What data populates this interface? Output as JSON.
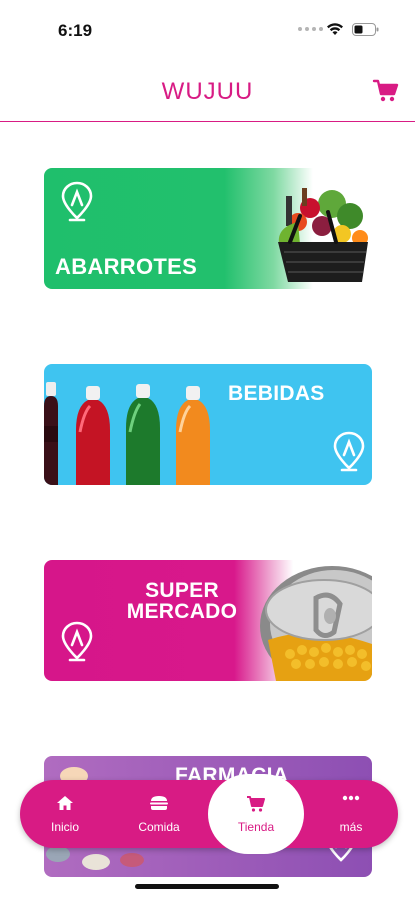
{
  "status_bar": {
    "time": "6:19",
    "icons": [
      "signal-dots-icon",
      "wifi-icon",
      "battery-icon"
    ]
  },
  "header": {
    "title": "WUJUU",
    "cart_icon": "shopping-cart-icon"
  },
  "categories": [
    {
      "label": "ABARROTES",
      "color": "#1fbf6c",
      "icon": "location-pin-icon",
      "image": "grocery-basket"
    },
    {
      "label": "BEBIDAS",
      "color": "#3fc4f0",
      "icon": "location-pin-icon",
      "image": "soda-bottles"
    },
    {
      "label_line1": "SUPER",
      "label_line2": "MERCADO",
      "color": "#d6168a",
      "icon": "location-pin-icon",
      "image": "open-can"
    },
    {
      "label": "FARMACIA",
      "color": "#9b5cbb",
      "icon": "location-pin-icon",
      "image": "pills"
    }
  ],
  "bottom_nav": {
    "items": [
      {
        "label": "Inicio",
        "icon": "home-icon"
      },
      {
        "label": "Comida",
        "icon": "burger-icon"
      },
      {
        "label": "Tienda",
        "icon": "shopping-cart-icon",
        "active": true
      },
      {
        "label": "más",
        "icon": "more-dots-icon"
      }
    ]
  },
  "colors": {
    "brand": "#d81b84",
    "abarrotes": "#1fbf6c",
    "bebidas": "#3fc4f0",
    "super_mercado": "#d6168a",
    "farmacia": "#9b5cbb"
  }
}
